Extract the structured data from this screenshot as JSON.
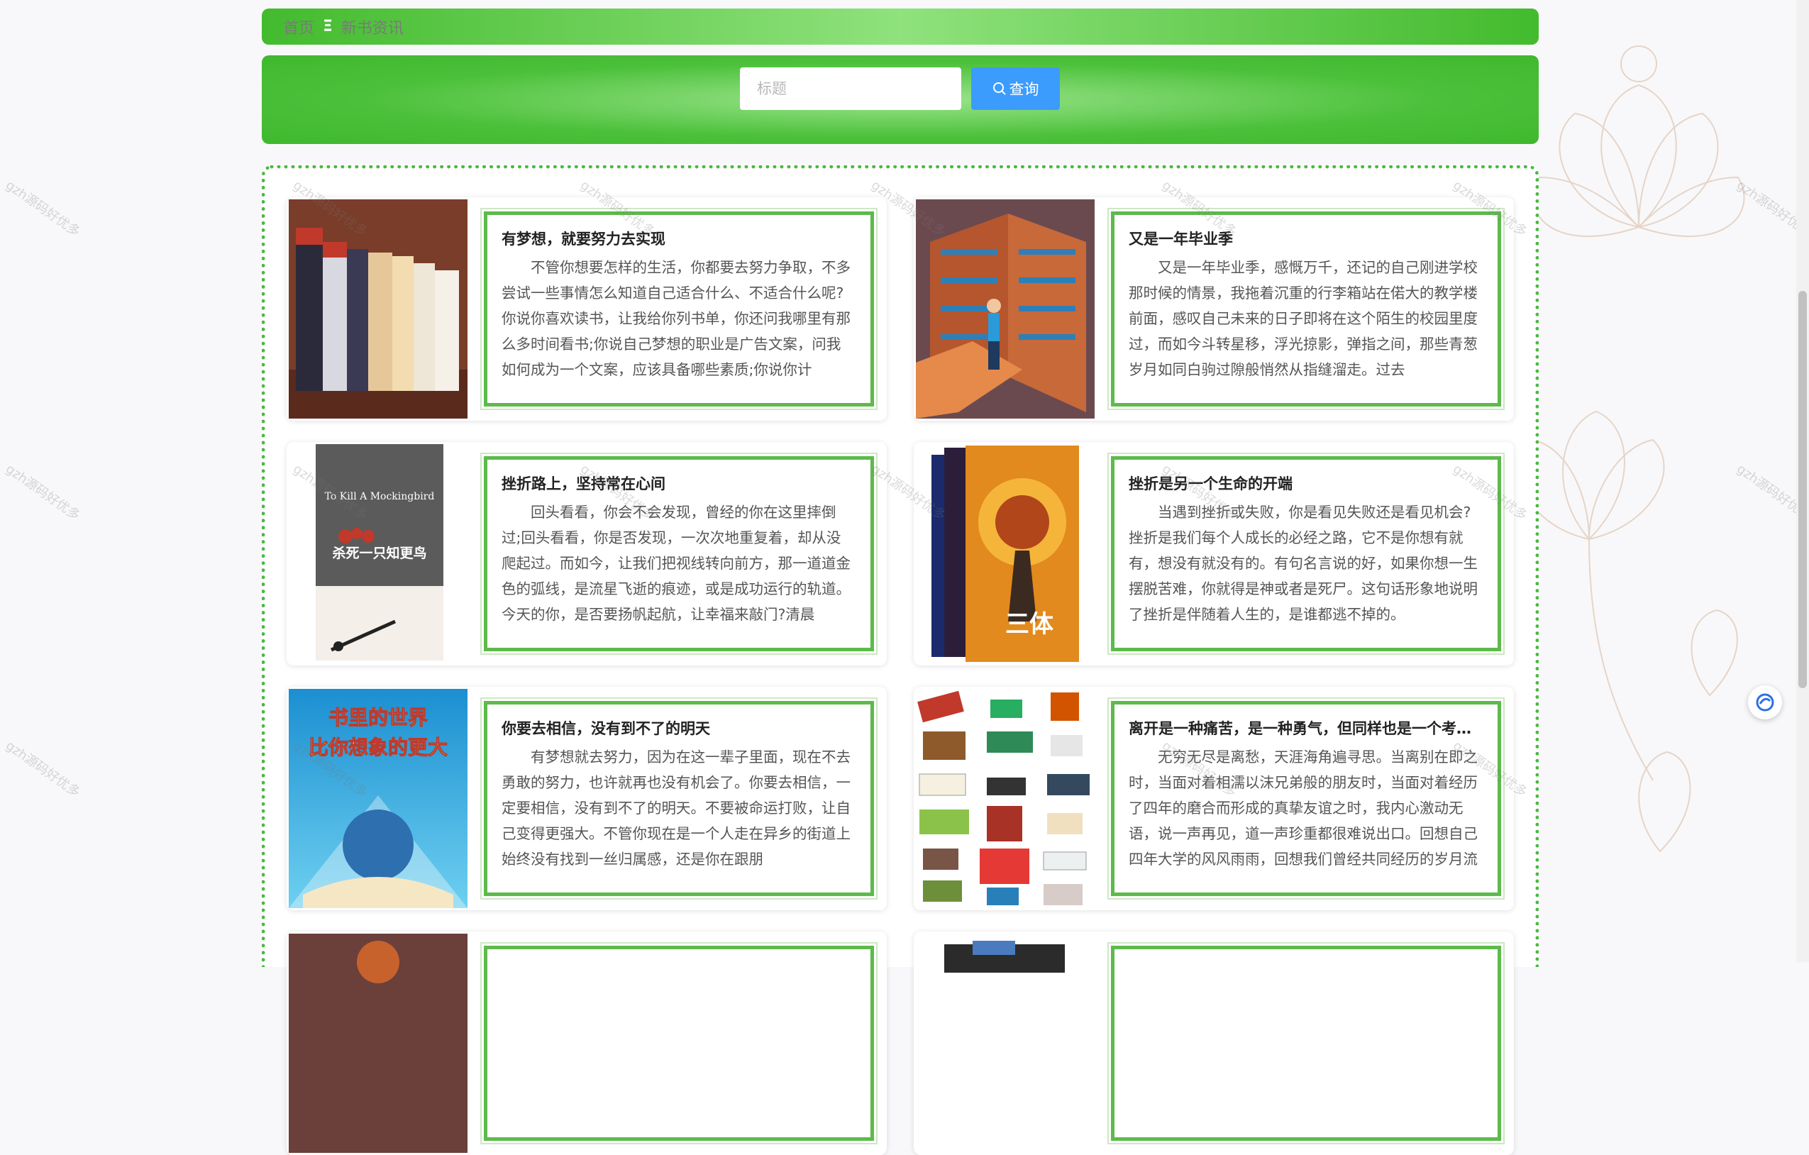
{
  "breadcrumb": {
    "home": "首页",
    "separator": "Ξ",
    "current": "新书资讯"
  },
  "search": {
    "placeholder": "标题",
    "value": "",
    "button_label": "查询",
    "button_icon": "search-icon"
  },
  "watermark_text": "gzh源码好优多",
  "articles": [
    {
      "title": "有梦想，就要努力去实现",
      "excerpt": "不管你想要怎样的生活，你都要去努力争取，不多尝试一些事情怎么知道自己适合什么、不适合什么呢?你说你喜欢读书，让我给你列书单，你还问我哪里有那么多时间看书;你说自己梦想的职业是广告文案，问我如何成为一个文案，应该具备哪些素质;你说你计",
      "image": "books-box-set"
    },
    {
      "title": "又是一年毕业季",
      "excerpt": "又是一年毕业季，感慨万千，还记的自己刚进学校那时候的情景，我拖着沉重的行李箱站在偌大的教学楼前面，感叹自己未来的日子即将在这个陌生的校园里度过，而如今斗转星移，浮光掠影，弹指之间，那些青葱岁月如同白驹过隙般悄然从指缝溜走。过去",
      "image": "library-illustration"
    },
    {
      "title": "挫折路上，坚持常在心间",
      "excerpt": "回头看看，你会不会发现，曾经的你在这里摔倒过;回头看看，你是否发现，一次次地重复着，却从没爬起过。而如今，让我们把视线转向前方，那一道道金色的弧线，是流星飞逝的痕迹，或是成功运行的轨道。今天的你，是否要扬帆起航，让幸福来敲门?清晨",
      "image": "mockingbird-book-cover"
    },
    {
      "title": "挫折是另一个生命的开端",
      "excerpt": "当遇到挫折或失败，你是看见失败还是看见机会?挫折是我们每个人成长的必经之路，它不是你想有就有，想没有就没有的。有句名言说的好，如果你想一生摆脱苦难，你就得是神或者是死尸。这句话形象地说明了挫折是伴随着人生的，是谁都逃不掉的。",
      "image": "three-body-book-cover"
    },
    {
      "title": "你要去相信，没有到不了的明天",
      "excerpt": "有梦想就去努力，因为在这一辈子里面，现在不去勇敢的努力，也许就再也没有机会了。你要去相信，一定要相信，没有到不了的明天。不要被命运打败，让自己变得更强大。不管你现在是一个人走在异乡的街道上始终没有找到一丝归属感，还是你在跟朋",
      "image": "world-in-book-poster"
    },
    {
      "title": "离开是一种痛苦，是一种勇气，但同样也是一个考验，是一种力量",
      "excerpt": "无穷无尽是离愁，天涯海角遍寻思。当离别在即之时，当面对着相濡以沫兄弟般的朋友时，当面对着经历了四年的磨合而形成的真挚友谊之时，我内心激动无语，说一声再见，道一声珍重都很难说出口。回想自己四年大学的风风雨雨，回想我们曾经共同经历的岁月流",
      "image": "book-icons-collage"
    },
    {
      "title": "",
      "excerpt": "",
      "image": "partial-thumbnail"
    },
    {
      "title": "",
      "excerpt": "",
      "image": "partial-thumbnail"
    }
  ],
  "cover_text": {
    "mockingbird_en": "To Kill A Mockingbird",
    "mockingbird_cn": "杀死一只知更鸟",
    "three_body": "三体",
    "world_poster_line1": "书里的世界",
    "world_poster_line2": "比你想象的更大"
  },
  "colors": {
    "accent_green": "#4bc03a",
    "button_blue": "#3b9cfd",
    "frame_green": "#5dba4b"
  }
}
